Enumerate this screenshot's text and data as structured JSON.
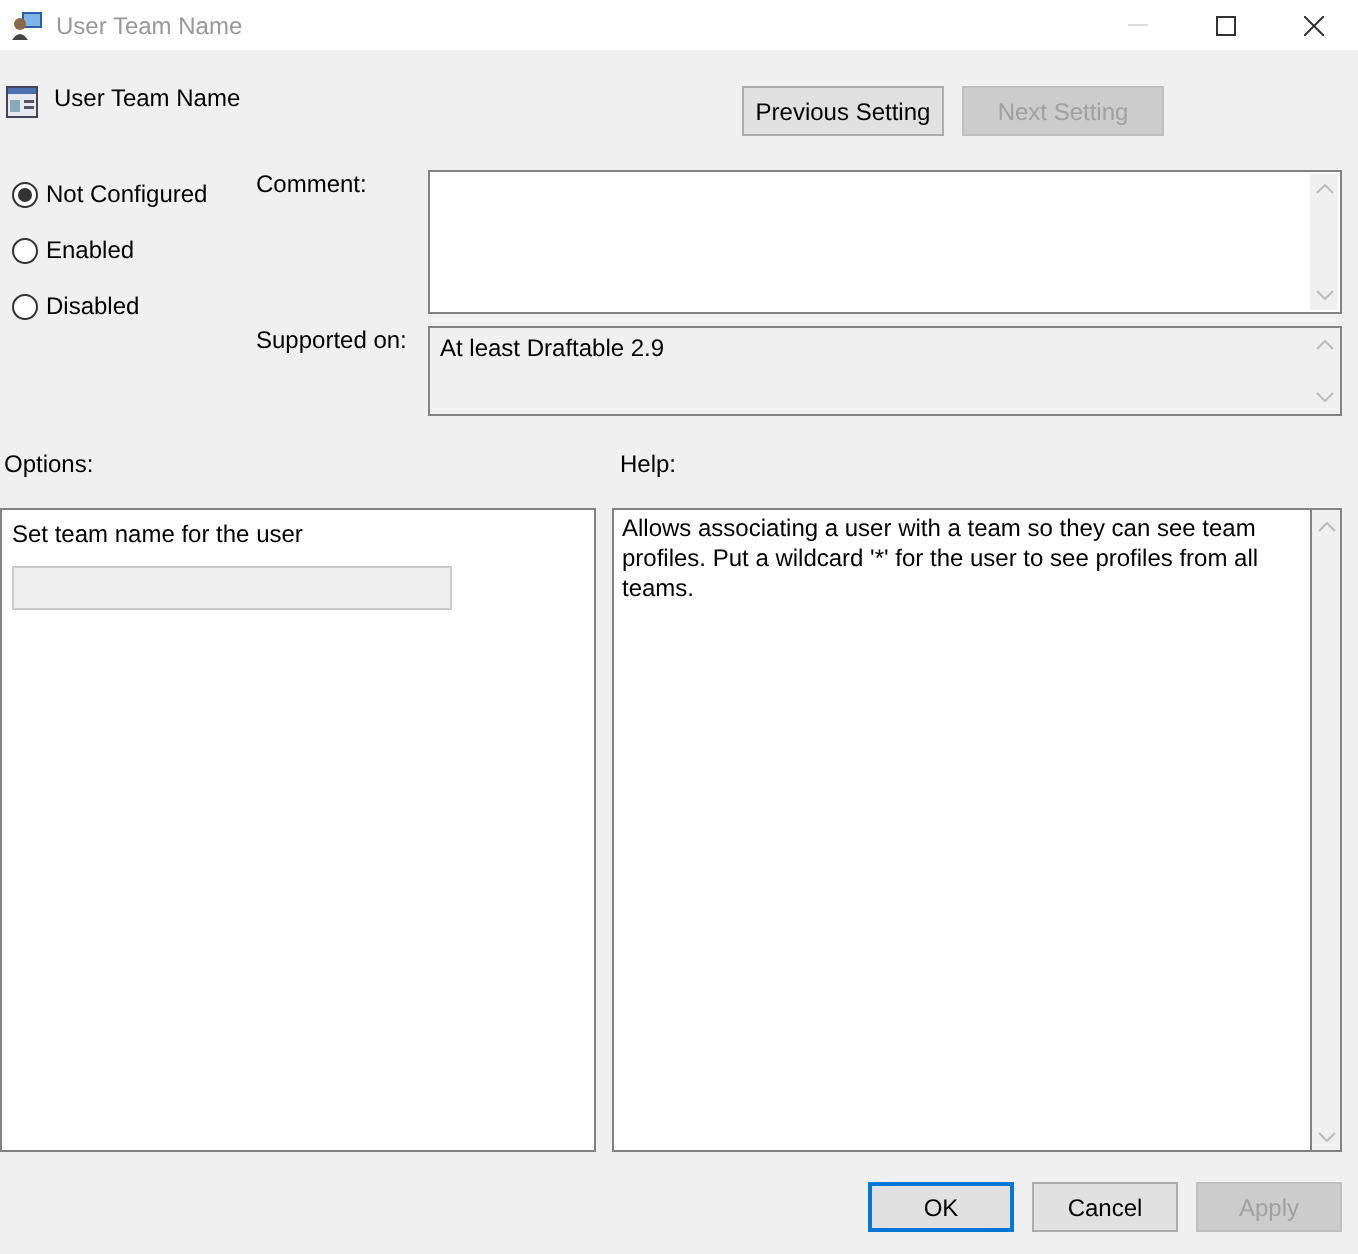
{
  "window": {
    "title": "User Team Name"
  },
  "header": {
    "title": "User Team Name"
  },
  "nav_buttons": [
    {
      "label": "Previous Setting",
      "disabled": false
    },
    {
      "label": "Next Setting",
      "disabled": true
    }
  ],
  "radios": [
    {
      "label": "Not Configured",
      "selected": true
    },
    {
      "label": "Enabled",
      "selected": false
    },
    {
      "label": "Disabled",
      "selected": false
    }
  ],
  "comment": {
    "label": "Comment:"
  },
  "supported_on": {
    "label": "Supported on:",
    "value": "At least Draftable 2.9"
  },
  "options": {
    "label": "Options:",
    "items": [
      {
        "kind": "text-field",
        "label": "Set team name for the user",
        "disabled": true
      }
    ]
  },
  "help": {
    "label": "Help:",
    "text": "Allows associating a user with a team so they can see team profiles. Put a wildcard '*' for the user to see profiles from all teams."
  },
  "buttons": [
    {
      "label": "OK",
      "default": true,
      "disabled": false
    },
    {
      "label": "Cancel",
      "default": false,
      "disabled": false
    },
    {
      "label": "Apply",
      "default": false,
      "disabled": true
    }
  ]
}
